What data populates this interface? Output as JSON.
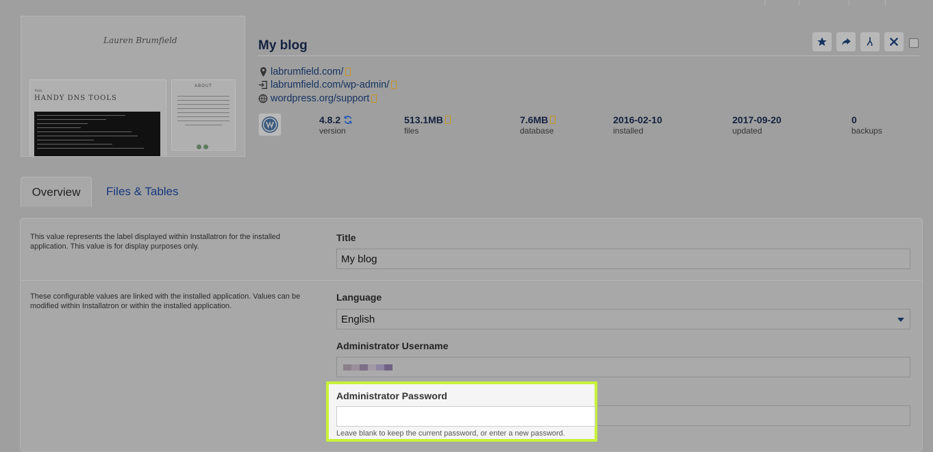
{
  "app": {
    "title": "My blog",
    "signature_text": "Lauren Brumfield",
    "preview": {
      "tools_label": "Tools",
      "heading": "HANDY DNS TOOLS",
      "about_label": "ABOUT"
    }
  },
  "links": [
    {
      "icon": "map-pin-icon",
      "text": "labrumfield.com/"
    },
    {
      "icon": "login-icon",
      "text": "labrumfield.com/wp-admin/"
    },
    {
      "icon": "globe-icon",
      "text": "wordpress.org/support"
    }
  ],
  "stats": [
    {
      "value": "4.8.2",
      "label": "version"
    },
    {
      "value": "513.1MB",
      "label": "files"
    },
    {
      "value": "7.6MB",
      "label": "database"
    },
    {
      "value": "2016-02-10",
      "label": "installed"
    },
    {
      "value": "2017-09-20",
      "label": "updated"
    },
    {
      "value": "0",
      "label": "backups"
    }
  ],
  "actions": [
    "star-icon",
    "share-icon",
    "clone-icon",
    "close-icon"
  ],
  "tabs": [
    {
      "label": "Overview",
      "active": true
    },
    {
      "label": "Files & Tables",
      "active": false
    }
  ],
  "sections": {
    "title_desc": "This value represents the label displayed within Installatron for the installed application. This value is for display purposes only.",
    "config_desc": "These configurable values are linked with the installed application. Values can be modified within Installatron or within the installed application."
  },
  "fields": {
    "title_label": "Title",
    "title_value": "My blog",
    "language_label": "Language",
    "language_value": "English",
    "username_label": "Administrator Username",
    "password_label": "Administrator Password",
    "password_value": "",
    "password_help": "Leave blank to keep the current password, or enter a new password."
  },
  "colors": {
    "highlight": "#c8f23a",
    "link": "#14325f",
    "accent": "#15377e"
  }
}
